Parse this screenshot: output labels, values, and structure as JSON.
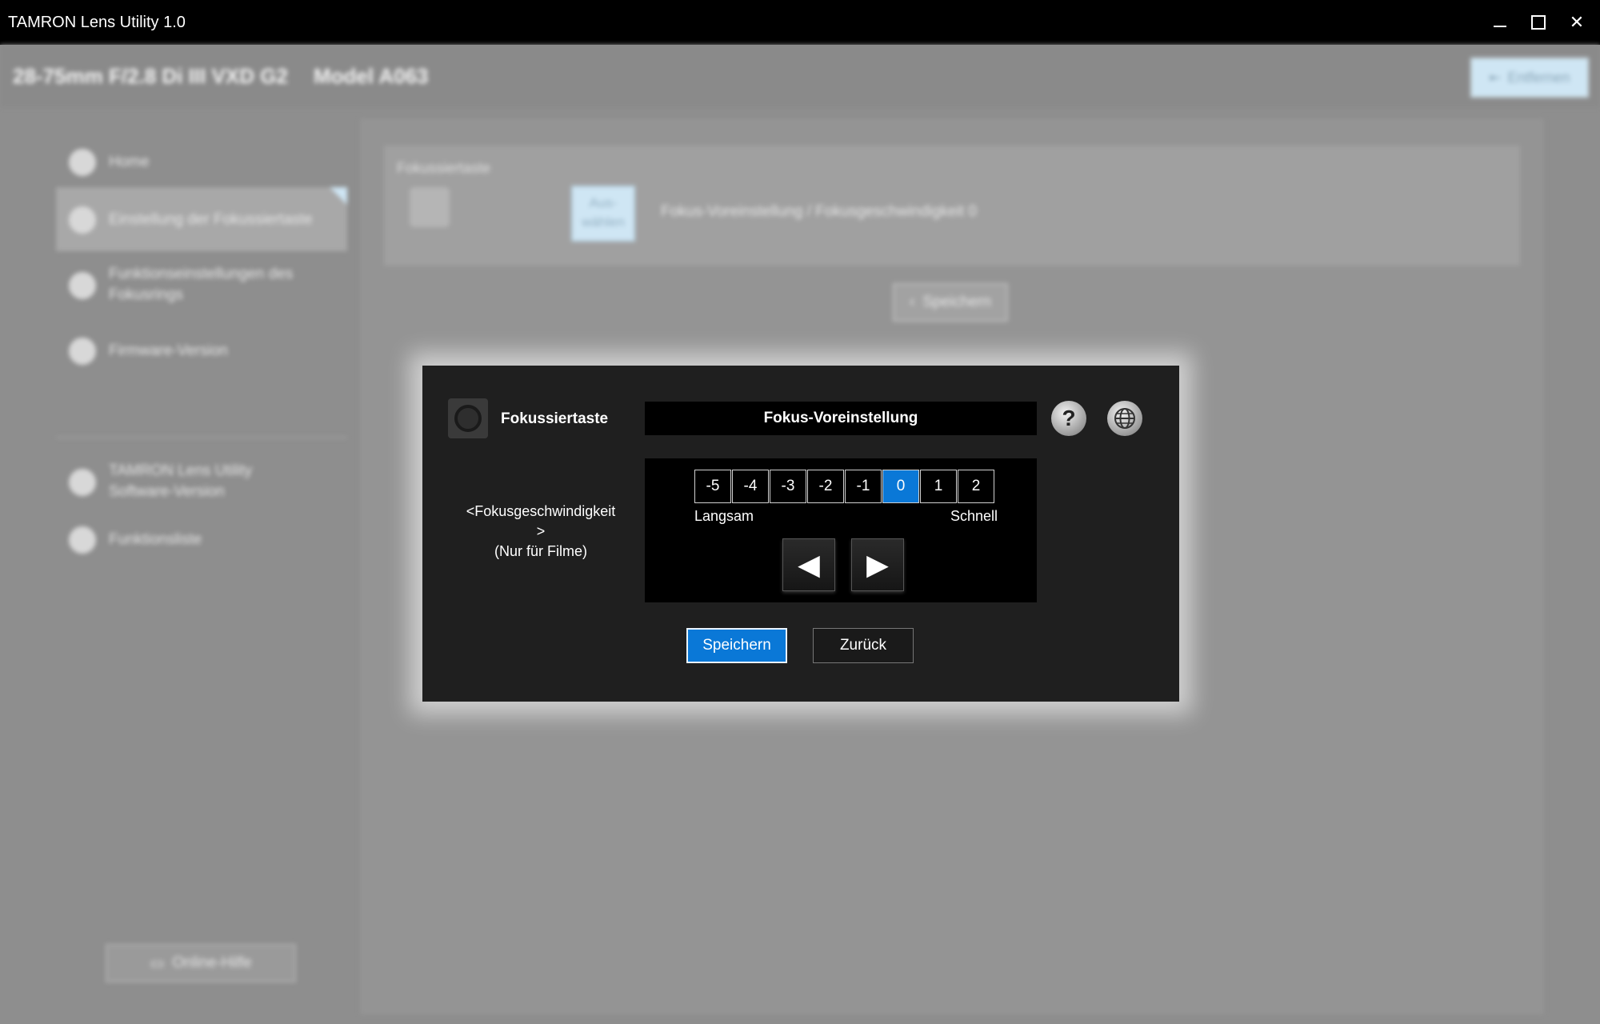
{
  "window": {
    "title": "TAMRON Lens Utility 1.0",
    "close_glyph": "✕"
  },
  "lensbar": {
    "lens_name": "28-75mm F/2.8 Di III VXD G2",
    "model": "Model A063",
    "remove_label": "Entfernen",
    "remove_icon": "exit-icon"
  },
  "sidebar": {
    "items": [
      {
        "label": "Home",
        "icon": "home-icon"
      },
      {
        "label": "Einstellung der Fokussiertaste",
        "icon": "finger-icon",
        "active": true
      },
      {
        "label": "Funktionseinstellungen des Fokusrings",
        "icon": "ring-icon"
      },
      {
        "label": "Firmware-Version",
        "icon": "firmware-icon"
      },
      {
        "label": "TAMRON Lens Utility Software-Version",
        "icon": "info-icon"
      },
      {
        "label": "Funktionsliste",
        "icon": "list-icon"
      }
    ],
    "online_help": "Online-Hilfe"
  },
  "card": {
    "label": "Fokussiertaste",
    "select_label": "Aus-wählen",
    "status": "Fokus-Voreinstellung  / Fokusgeschwindigkeit 0",
    "save_label": "Speichern"
  },
  "dialog": {
    "title": "Fokussiertaste",
    "mode": "Fokus-Voreinstellung",
    "help_glyph": "?",
    "speed_label": "<Fokusgeschwindigkeit\n>\n(Nur für Filme)",
    "steps": [
      "-5",
      "-4",
      "-3",
      "-2",
      "-1",
      "0",
      "1",
      "2"
    ],
    "selected_step": "0",
    "slow_label": "Langsam",
    "fast_label": "Schnell",
    "left_arrow": "◀",
    "right_arrow": "▶",
    "save_label": "Speichern",
    "back_label": "Zurück"
  },
  "colors": {
    "accent": "#0a78d7",
    "dialog_bg": "#1f1f1f",
    "titlebar_bg": "#000000"
  }
}
